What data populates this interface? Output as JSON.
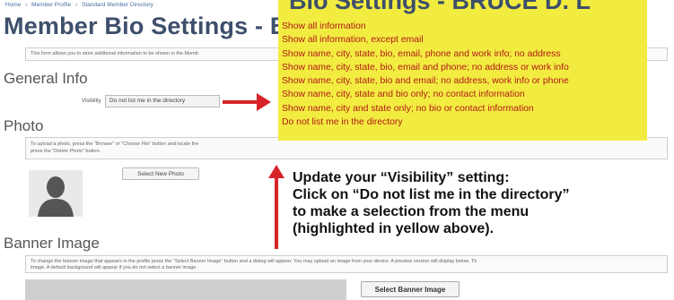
{
  "breadcrumb": [
    "Home",
    "Member Profile",
    "Standard Member Directory"
  ],
  "breadcrumb_sep": "›",
  "page_title": "Member Bio Settings - BR",
  "title_peek": "Bio Settings - BRUCE D. L",
  "intro_text": "This form allows you to store additional information to be shown in the Memb",
  "general": {
    "heading": "General Info",
    "visibility_label": "Visibility",
    "visibility_value": "Do not list me in the directory"
  },
  "photo": {
    "heading": "Photo",
    "info_text": "To upload a photo, press the \"Browse\" or \"Choose File\" button and locate the",
    "info_text2": "press the \"Delete Photo\" button.",
    "select_button": "Select New Photo"
  },
  "banner": {
    "heading": "Banner Image",
    "info_text": "To change the banner image that appears in the profile press the \"Select Banner Image\" button and a dialog will appear. You may upload an image from your device. A preview version will display below. Th",
    "info_text2": "image. A default background will appear if you do not select a banner image.",
    "select_button": "Select Banner Image"
  },
  "dropdown": {
    "options": [
      "Show all information",
      "Show all information, except email",
      "Show name, city, state, bio, email, phone and work info; no address",
      "Show name, city, state, bio, email and phone; no address or work info",
      "Show name, city, state, bio and email; no address, work info or phone",
      "Show name, city, state and bio only; no contact information",
      "Show name, city and state only; no bio or contact information",
      "Do not list me in the directory"
    ]
  },
  "callout": {
    "line1": "Update your “Visibility” setting:",
    "line2": "Click on “Do not list me in the directory”",
    "line3": "to make a selection from the menu",
    "line4": "(highlighted in yellow above)."
  },
  "colors": {
    "highlight": "#f2ec40",
    "arrow": "#d8232a",
    "option_text": "#b21818"
  }
}
